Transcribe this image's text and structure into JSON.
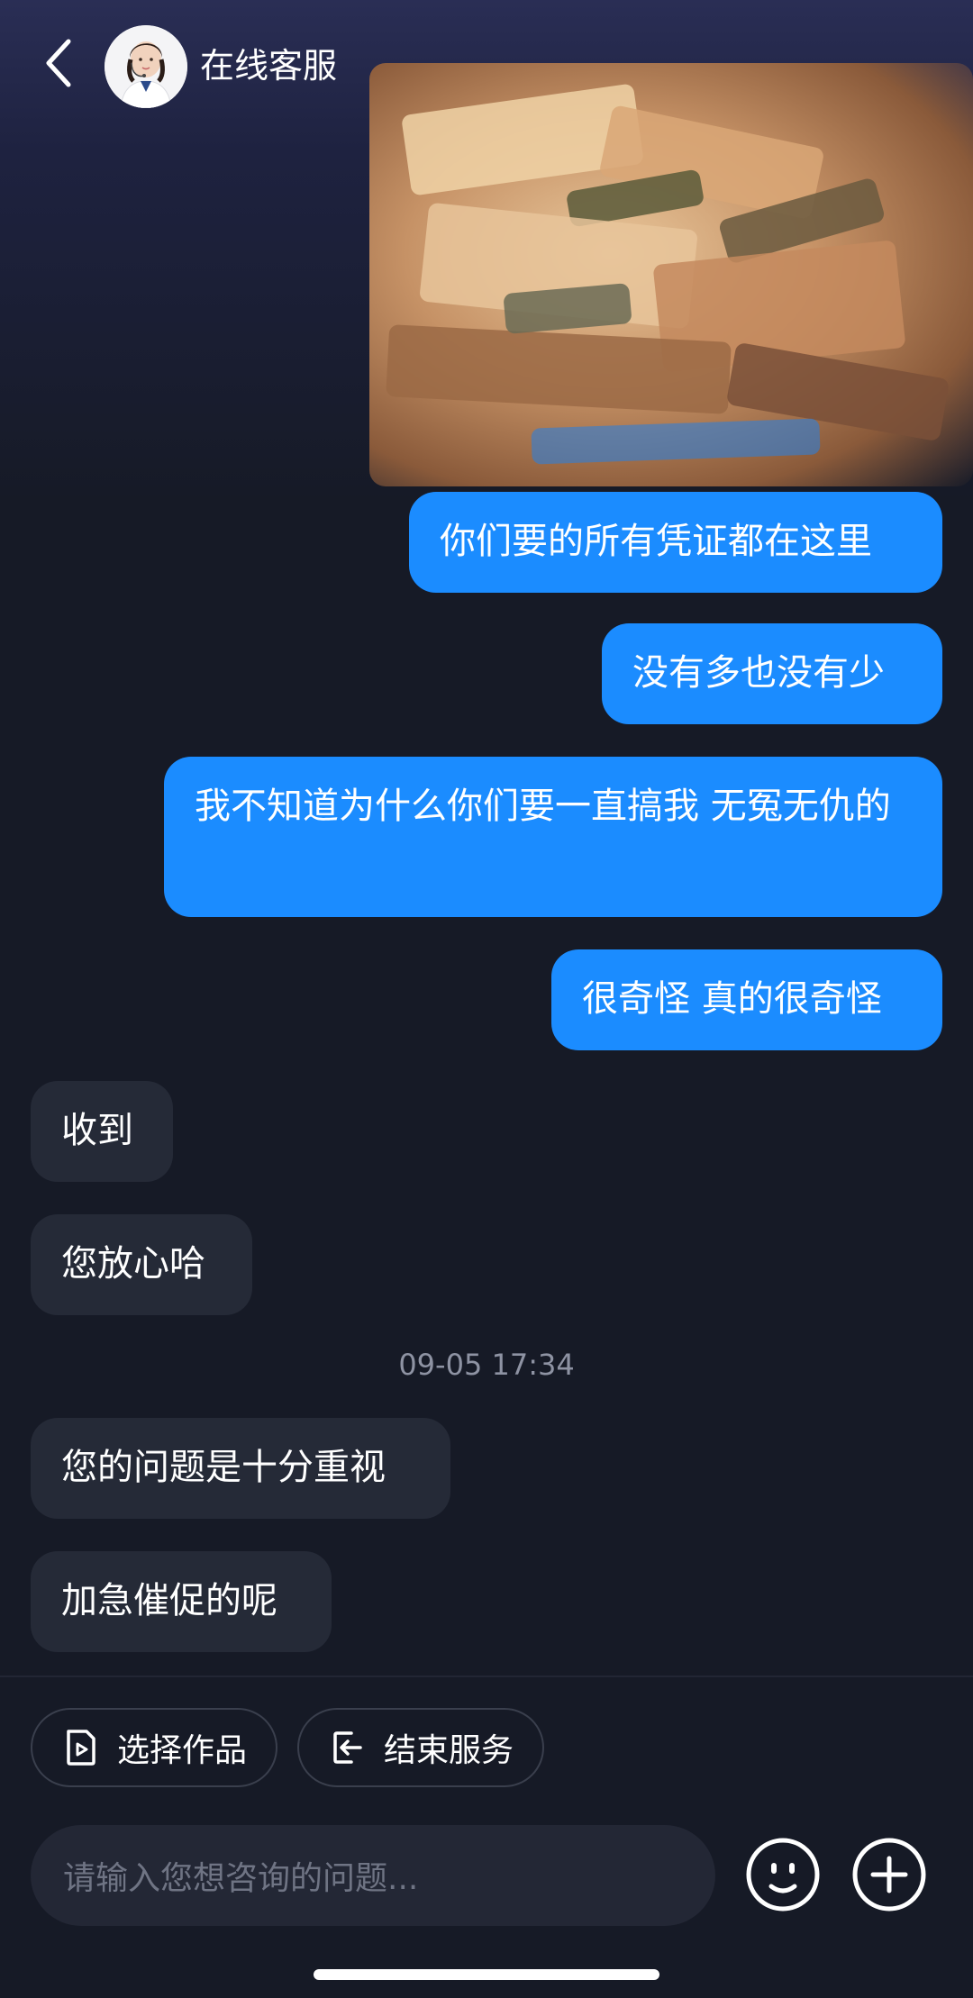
{
  "header": {
    "title": "在线客服",
    "icons": {
      "back": "chevron-left-icon",
      "avatar": "support-agent-avatar"
    }
  },
  "messages": [
    {
      "from": "me",
      "text": "你们要的所有凭证都在这里"
    },
    {
      "from": "me",
      "text": "没有多也没有少"
    },
    {
      "from": "me",
      "text": "我不知道为什么你们要一直搞我 无冤无仇的"
    },
    {
      "from": "me",
      "text": "很奇怪 真的很奇怪"
    },
    {
      "from": "them",
      "text": "收到"
    },
    {
      "from": "them",
      "text": "您放心哈"
    },
    {
      "from": "them",
      "text": "您的问题是十分重视"
    },
    {
      "from": "them",
      "text": "加急催促的呢"
    }
  ],
  "timestamp": "09-05 17:34",
  "actions": {
    "select_work": "选择作品",
    "end_service": "结束服务"
  },
  "composer": {
    "placeholder": "请输入您想咨询的问题...",
    "icons": {
      "emoji": "emoji-icon",
      "add": "plus-circle-icon"
    }
  },
  "colors": {
    "background": "#161a26",
    "my_bubble": "#1b8cff",
    "their_bubble": "#252a37",
    "muted_text": "#8e93a3"
  }
}
